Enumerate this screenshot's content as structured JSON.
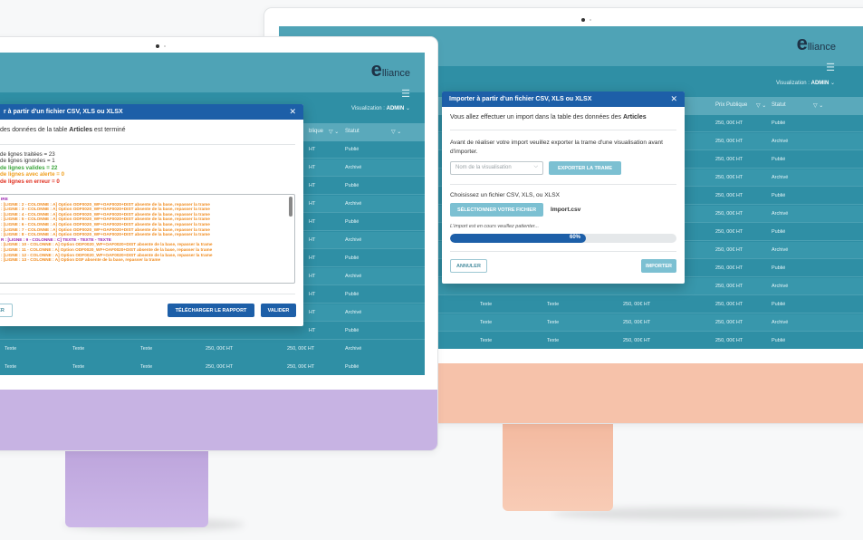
{
  "logo": {
    "letter": "e",
    "rest": "lliance"
  },
  "hamburger_icon": "☰",
  "visualisation": {
    "label": "Visualization : ",
    "user": "ADMIN"
  },
  "back_monitor": {
    "columns": [
      "Prix Publique",
      "Statut"
    ],
    "rows": [
      {
        "price": "250, 00€ HT",
        "status": "Publié"
      },
      {
        "price": "250, 00€ HT",
        "status": "Archivé"
      },
      {
        "price": "250, 00€ HT",
        "status": "Publié"
      },
      {
        "price": "250, 00€ HT",
        "status": "Archivé"
      },
      {
        "price": "250, 00€ HT",
        "status": "Publié"
      },
      {
        "price": "250, 00€ HT",
        "status": "Archivé"
      },
      {
        "price": "250, 00€ HT",
        "status": "Publié"
      },
      {
        "price": "250, 00€ HT",
        "status": "Archivé"
      },
      {
        "price": "250, 00€ HT",
        "status": "Publié"
      },
      {
        "price": "250, 00€ HT",
        "status": "Archivé"
      },
      {
        "price": "250, 00€ HT",
        "status": "Publié"
      },
      {
        "price": "250, 00€ HT",
        "status": "Archivé"
      },
      {
        "price": "250, 00€ HT",
        "status": "Publié"
      }
    ],
    "bottom_rows": [
      {
        "c1": "Texte",
        "c2": "Texte",
        "price": "250, 00€ HT"
      },
      {
        "c1": "Texte",
        "c2": "Texte",
        "price": "250, 00€ HT"
      },
      {
        "c1": "Texte",
        "c2": "Texte",
        "price": "250, 00€ HT"
      }
    ],
    "modal": {
      "title": "Importer à partir d'un fichier CSV, XLS ou XLSX",
      "close": "✕",
      "intro_prefix": "Vous allez effectuer un import dans la table des données des ",
      "intro_table": "Articles",
      "export_text_1": "Avant de réaliser votre import veuillez exporter la trame d'une visualisation avant",
      "export_text_2": "d'importer.",
      "select_placeholder": "Nom de la visualisation",
      "export_button": "EXPORTER LA TRAME",
      "choose_text": "Choisissez un fichier CSV, XLS, ou XLSX",
      "select_file_button": "SÉLECTIONNER VOTRE FICHIER",
      "file_name": "Import.csv",
      "progress_text": "L'import est en cours veuillez patienter...",
      "progress_label": "60%",
      "progress_value": 0.6,
      "cancel_button": "ANNULER",
      "import_button": "IMPORTER"
    }
  },
  "front_monitor": {
    "columns": [
      "blique",
      "Statut"
    ],
    "rows": [
      {
        "price": "HT",
        "status": "Publié"
      },
      {
        "price": "HT",
        "status": "Archivé"
      },
      {
        "price": "HT",
        "status": "Publié"
      },
      {
        "price": "HT",
        "status": "Archivé"
      },
      {
        "price": "HT",
        "status": "Publié"
      },
      {
        "price": "HT",
        "status": "Archivé"
      },
      {
        "price": "HT",
        "status": "Publié"
      },
      {
        "price": "HT",
        "status": "Archivé"
      },
      {
        "price": "HT",
        "status": "Publié"
      },
      {
        "price": "HT",
        "status": "Archivé"
      },
      {
        "price": "HT",
        "status": "Publié"
      }
    ],
    "bottom_rows": [
      {
        "c1": "Texte",
        "c2": "Texte",
        "c3": "Texte",
        "price": "250, 00€ HT",
        "price2": "250, 00€ HT",
        "status": "Archivé"
      },
      {
        "c1": "Texte",
        "c2": "Texte",
        "c3": "Texte",
        "price": "250, 00€ HT",
        "price2": "250, 00€ HT",
        "status": "Publié"
      }
    ],
    "modal": {
      "title": "r à partir d'un fichier CSV, XLS ou XLSX",
      "close": "✕",
      "intro_prefix": "des données de la table ",
      "intro_table": "Articles",
      "intro_suffix": " est terminé",
      "summary": [
        {
          "text": "de lignes traitées  = 23",
          "color": "#333333"
        },
        {
          "text": "de lignes ignorées = 1",
          "color": "#333333"
        },
        {
          "text": "de lignes valides = 22",
          "color": "#3aa53a"
        },
        {
          "text": "de lignes avec alerte = 0",
          "color": "#f0a020"
        },
        {
          "text": "de lignes en erreur = 0",
          "color": "#e03020"
        }
      ],
      "log": [
        {
          "text": "IRE",
          "color": "#9b27b0"
        },
        {
          "text": ": [LIGNE : 2 - COLONNE : A]  Option ODF0020_WF+OAF0020+DIST absente de la base, repasser la trame",
          "color": "#f08a1c"
        },
        {
          "text": ": [LIGNE : 3 - COLONNE : A]  Option ODF0020_WF+OAF0020+DIST absente de la base, repasser la trame",
          "color": "#f08a1c"
        },
        {
          "text": ": [LIGNE : 4 - COLONNE : A]  Option ODF0020_WF+OAF0020+DIST absente de la base, repasser la trame",
          "color": "#f08a1c"
        },
        {
          "text": ": [LIGNE : 5 - COLONNE : A]  Option ODF0020_WF+OAF0020+DIST absente de la base, repasser la trame",
          "color": "#f08a1c"
        },
        {
          "text": ": [LIGNE : 6 - COLONNE : A]  Option ODF0020_WF+OAF0020+DIST absente de la base, repasser la trame",
          "color": "#f08a1c"
        },
        {
          "text": ": [LIGNE : 7 - COLONNE : A]  Option ODF0020_WF+OAF0020+DIST absente de la base, repasser la trame",
          "color": "#f08a1c"
        },
        {
          "text": ": [LIGNE : 8 - COLONNE : A]  Option ODF0020_WF+OAF0020+DIST absente de la base, repasser la trame",
          "color": "#f08a1c"
        },
        {
          "text": "R : [LIGNE : 9 - COLONNE : C]  TEXTE - TEXTE - TEXTE",
          "color": "#9b27b0"
        },
        {
          "text": ": [LIGNE : 10 - COLONNE : A]  Option ODF0020_WF+OAF0020+DIST absente de la base, repasser la trame",
          "color": "#f08a1c"
        },
        {
          "text": ": [LIGNE : 11 - COLONNE : A]  Option ODF0020_WF+OAF0020+DIST absente de la base, repasser la trame",
          "color": "#f08a1c"
        },
        {
          "text": ": [LIGNE : 12 - COLONNE : A]  Option ODF0020_WF+OAF0020+DIST absente de la base, repasser la trame",
          "color": "#f08a1c"
        },
        {
          "text": ": [LIGNE : 13 - COLONNE : A]  Option DSF absente de la base, repasser la trame",
          "color": "#f08a1c"
        }
      ],
      "cancel_button": "ER",
      "report_button": "TÉLÉCHARGER LE RAPPORT",
      "validate_button": "VALIDER"
    }
  },
  "colors": {
    "brand_blue": "#1d5fa8",
    "teal": "#2f8fa5",
    "front_chin": "#c7b3e3",
    "back_chin": "#f6c2aa"
  }
}
